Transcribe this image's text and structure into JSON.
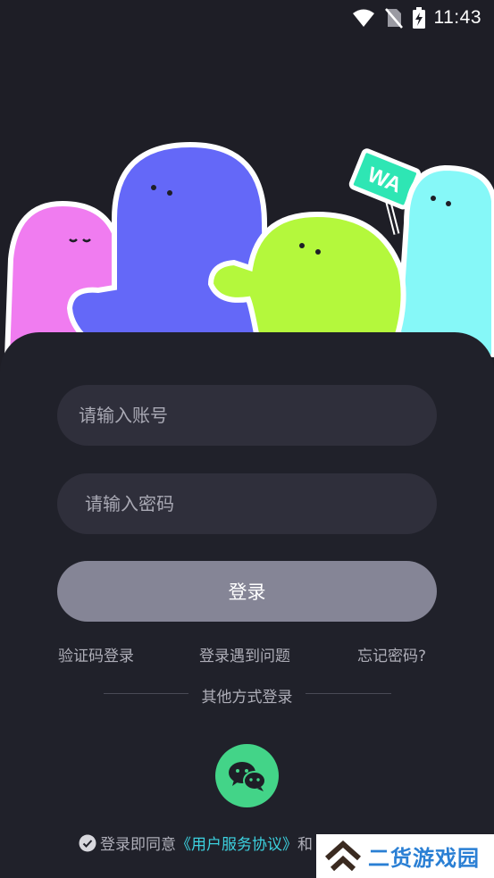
{
  "status_bar": {
    "time": "11:43",
    "icons": [
      "wifi-icon",
      "no-sim-icon",
      "battery-charging-icon"
    ]
  },
  "hero": {
    "sign_text": "WA"
  },
  "form": {
    "account_placeholder": "请输入账号",
    "password_placeholder": "请输入密码",
    "login_label": "登录"
  },
  "links": {
    "sms_login": "验证码登录",
    "login_problem": "登录遇到问题",
    "forgot_password": "忘记密码?"
  },
  "other_login": {
    "label": "其他方式登录",
    "wechat_icon": "wechat-icon",
    "wechat_color": "#43d488"
  },
  "agreement": {
    "prefix": "登录即同意",
    "link": "《用户服务协议》",
    "suffix": "和"
  },
  "watermark": {
    "text": "二货游戏园"
  },
  "colors": {
    "background": "#1e1e26",
    "panel": "#20212a",
    "input": "#2f2f3b",
    "button": "#858596",
    "accent_link": "#3cd2e0"
  }
}
